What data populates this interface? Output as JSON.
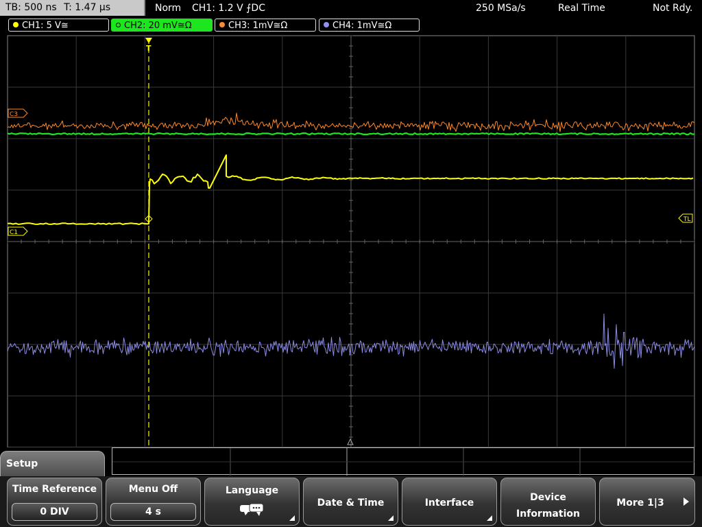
{
  "topbar": {
    "timebase": "TB: 500 ns",
    "trigger_time": "T: 1.47 µs",
    "mode": "Norm",
    "trigger_setting": "CH1: 1.2 V ⨍DC",
    "sample_rate": "250 MSa/s",
    "acq_mode": "Real Time",
    "status": "Not Rdy."
  },
  "channels": [
    {
      "label": "CH1: 5 V≅",
      "color": "#ffff00",
      "active": false
    },
    {
      "label": "CH2: 20 mV≅Ω",
      "color": "#1ee61e",
      "active": true
    },
    {
      "label": "CH3: 1mV≅Ω",
      "color": "#ff8a2a",
      "active": false
    },
    {
      "label": "CH4: 1mV≅Ω",
      "color": "#9090f0",
      "active": false
    }
  ],
  "markers": {
    "c3": "C3",
    "c1": "C1",
    "tl": "TL",
    "trigger_pos": "T"
  },
  "menu": {
    "title": "Setup",
    "softkeys": [
      {
        "label": "Time Reference",
        "value": "0 DIV"
      },
      {
        "label": "Menu Off",
        "value": "4 s"
      },
      {
        "label": "Language",
        "icon": "speech-bubble-icon"
      },
      {
        "label": "Date & Time"
      },
      {
        "label": "Interface"
      },
      {
        "label": "Device Information"
      },
      {
        "label": "More 1|3"
      }
    ]
  }
}
